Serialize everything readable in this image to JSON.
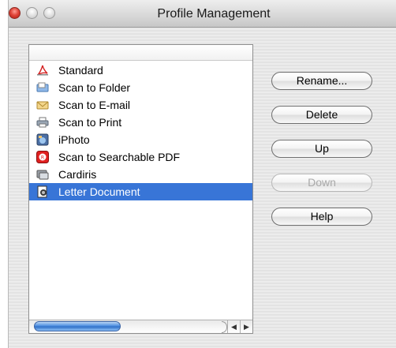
{
  "window": {
    "title": "Profile Management"
  },
  "profiles": [
    {
      "label": "Standard",
      "icon": "pdf-acrobat-icon",
      "selected": false
    },
    {
      "label": "Scan to Folder",
      "icon": "folder-scan-icon",
      "selected": false
    },
    {
      "label": "Scan to E-mail",
      "icon": "email-icon",
      "selected": false
    },
    {
      "label": "Scan to Print",
      "icon": "printer-icon",
      "selected": false
    },
    {
      "label": "iPhoto",
      "icon": "iphoto-icon",
      "selected": false
    },
    {
      "label": "Scan to Searchable PDF",
      "icon": "searchable-pdf-icon",
      "selected": false
    },
    {
      "label": "Cardiris",
      "icon": "cardiris-icon",
      "selected": false
    },
    {
      "label": "Letter Document",
      "icon": "letter-document-icon",
      "selected": true
    }
  ],
  "buttons": {
    "rename": "Rename...",
    "delete": "Delete",
    "up": "Up",
    "down": "Down",
    "help": "Help"
  },
  "button_states": {
    "down_enabled": false
  },
  "colors": {
    "selection": "#3875d7",
    "close_button": "#e0463a",
    "scroll_thumb": "#4f8fe1"
  }
}
